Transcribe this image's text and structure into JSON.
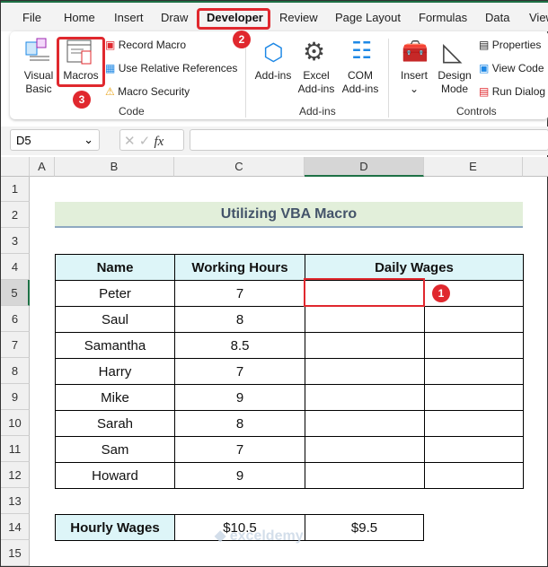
{
  "tabs": [
    "File",
    "Home",
    "Insert",
    "Draw",
    "Developer",
    "Review",
    "Page Layout",
    "Formulas",
    "Data",
    "View"
  ],
  "ribbon": {
    "visual_basic": "Visual Basic",
    "macros": "Macros",
    "record_macro": "Record Macro",
    "use_relative": "Use Relative References",
    "macro_security": "Macro Security",
    "code_group": "Code",
    "addins": "Add-ins",
    "excel_addins": "Excel Add-ins",
    "com_addins": "COM Add-ins",
    "addins_group": "Add-ins",
    "insert": "Insert",
    "design_mode": "Design Mode",
    "properties": "Properties",
    "view_code": "View Code",
    "run_dialog": "Run Dialog",
    "controls_group": "Controls"
  },
  "badges": [
    "1",
    "2",
    "3"
  ],
  "formula_bar": {
    "name_box": "D5",
    "fx": "fx",
    "formula": ""
  },
  "columns": [
    "A",
    "B",
    "C",
    "D",
    "E"
  ],
  "rows": [
    "1",
    "2",
    "3",
    "4",
    "5",
    "6",
    "7",
    "8",
    "9",
    "10",
    "11",
    "12",
    "13",
    "14",
    "15"
  ],
  "sheet": {
    "title": "Utilizing  VBA Macro",
    "headers": [
      "Name",
      "Working Hours",
      "Daily Wages"
    ],
    "data": [
      [
        "Peter",
        "7"
      ],
      [
        "Saul",
        "8"
      ],
      [
        "Samantha",
        "8.5"
      ],
      [
        "Harry",
        "7"
      ],
      [
        "Mike",
        "9"
      ],
      [
        "Sarah",
        "8"
      ],
      [
        "Sam",
        "7"
      ],
      [
        "Howard",
        "9"
      ]
    ],
    "hourly_label": "Hourly Wages",
    "hourly_1": "$10.5",
    "hourly_2": "$9.5"
  },
  "watermark": "exceldemy EXCEL · DATA · BI",
  "colors": {
    "accent": "#e0282e",
    "header_fill": "#ddf5f8",
    "title_fill": "#e2efda"
  }
}
